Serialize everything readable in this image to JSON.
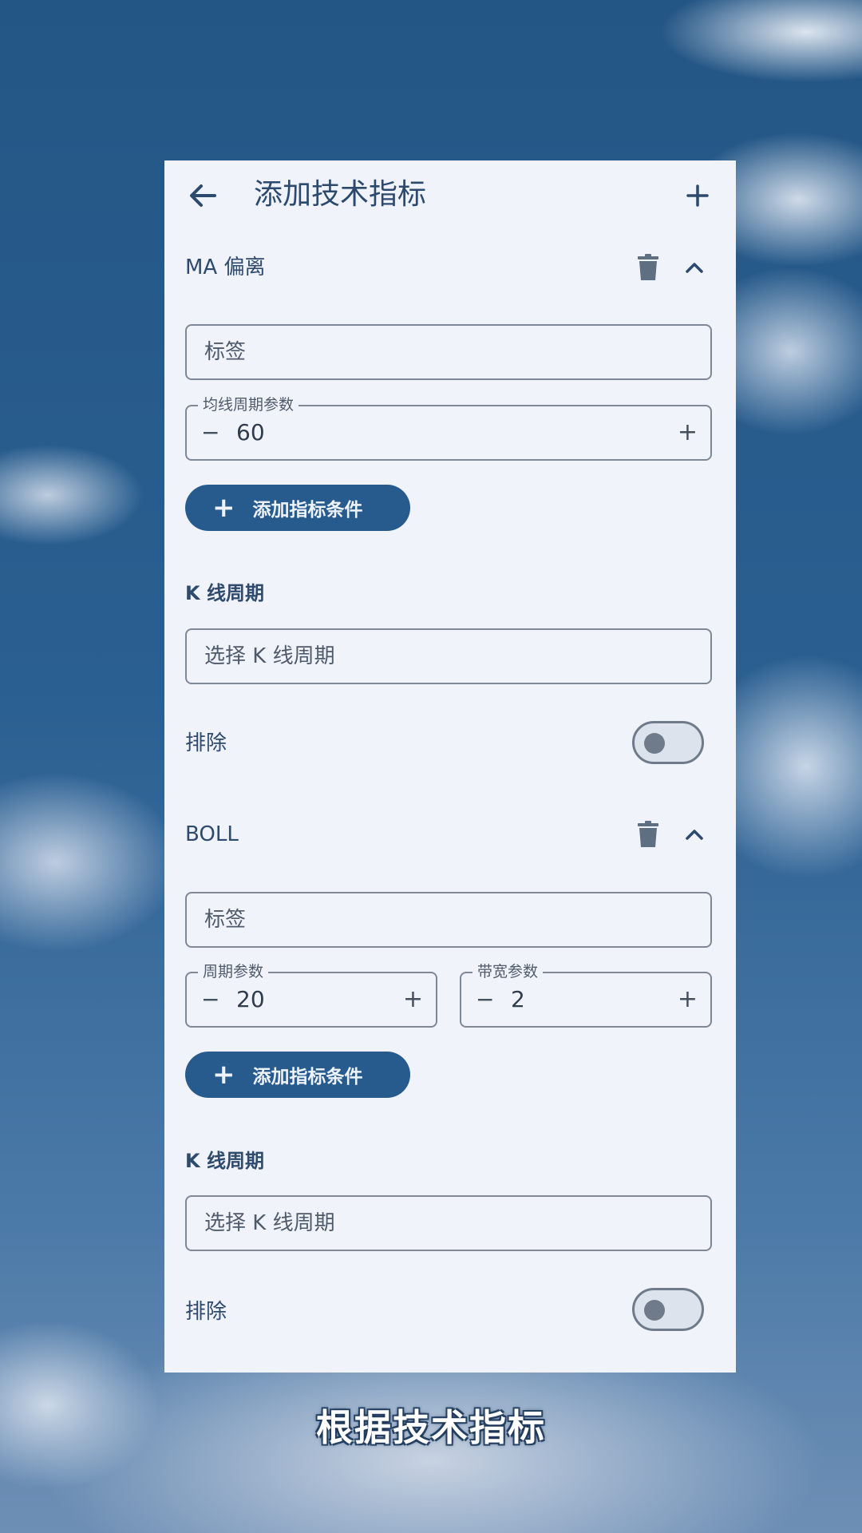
{
  "header": {
    "title": "添加技术指标"
  },
  "indicators": [
    {
      "name": "MA 偏离",
      "label_placeholder": "标签",
      "params": [
        {
          "legend": "均线周期参数",
          "value": "60"
        }
      ],
      "add_condition_label": "添加指标条件",
      "kline_title": "K 线周期",
      "kline_placeholder": "选择 K 线周期",
      "exclude_label": "排除",
      "exclude_on": false
    },
    {
      "name": "BOLL",
      "label_placeholder": "标签",
      "params": [
        {
          "legend": "周期参数",
          "value": "20"
        },
        {
          "legend": "带宽参数",
          "value": "2"
        }
      ],
      "add_condition_label": "添加指标条件",
      "kline_title": "K 线周期",
      "kline_placeholder": "选择 K 线周期",
      "exclude_label": "排除",
      "exclude_on": false
    }
  ],
  "icons": {
    "back": "back-arrow-icon",
    "add": "plus-icon",
    "delete": "trash-icon",
    "collapse": "chevron-up-icon"
  },
  "caption": "根据技术指标",
  "colors": {
    "accent": "#285b8d",
    "panel": "#f1f3fb",
    "text": "#2e4a6c"
  }
}
